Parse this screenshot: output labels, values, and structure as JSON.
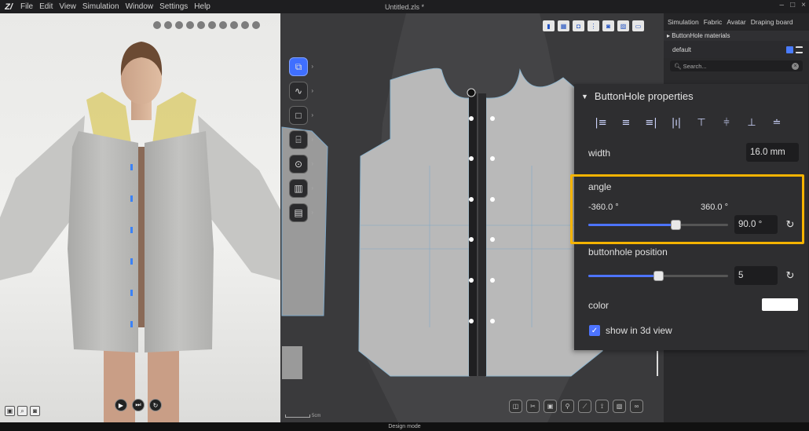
{
  "app": {
    "logo": "Z/",
    "document_title": "Untitled.zls *",
    "menu": [
      "File",
      "Edit",
      "View",
      "Simulation",
      "Window",
      "Settings",
      "Help"
    ],
    "window_controls": [
      "–",
      "□",
      "×"
    ]
  },
  "view3d": {
    "toolbar_icons": [
      "hide-icon",
      "texture-icon",
      "layers-icon",
      "avatar-icon",
      "fabric-icon",
      "color-icon",
      "pattern-icon",
      "pin-icon",
      "sewing-icon",
      "measure-icon"
    ],
    "bottom_icons": [
      "screenshot-icon",
      "zoom-icon",
      "camera-icon"
    ],
    "playback": [
      "play-icon",
      "step-icon",
      "reset-icon"
    ]
  },
  "view2d": {
    "left_tools": [
      "transform-pattern-icon",
      "segment-icon",
      "rectangle-icon",
      "sewing-icon",
      "button-icon",
      "map-icon",
      "tape-icon"
    ],
    "top_icons": [
      "fit-icon",
      "sheet-icon",
      "pin-icon",
      "sewing-view-icon",
      "notch-icon",
      "grainline-icon",
      "info-icon"
    ],
    "bottom_icons": [
      "select-icon",
      "cut-icon",
      "fold-icon",
      "tack-icon",
      "strap-icon",
      "pin2-icon",
      "glue-icon",
      "link-icon"
    ],
    "scale": "5cm"
  },
  "right_panel": {
    "tabs": [
      "Simulation",
      "Fabric",
      "Avatar",
      "Draping board"
    ],
    "section": "▸ ButtonHole materials",
    "default_label": "default",
    "search_placeholder": "Search...",
    "search_clear": "×"
  },
  "buttonhole_panel": {
    "title": "ButtonHole properties",
    "collapse_glyph": "▼",
    "align_icons": [
      "|≡",
      "≡",
      "≡|",
      "|ı|",
      "⊤",
      "⫩",
      "⊥",
      "≐"
    ],
    "width_label": "width",
    "width_value": "16.0 mm",
    "angle_label": "angle",
    "angle_min": "-360.0 °",
    "angle_max": "360.0 °",
    "angle_value": "90.0 °",
    "angle_fraction": 0.625,
    "position_label": "buttonhole position",
    "position_value": "5",
    "position_fraction": 0.5,
    "color_label": "color",
    "color_value": "#ffffff",
    "show3d_label": "show in 3d view",
    "show3d_checked": true,
    "reset_glyph": "↻"
  },
  "status_bar": {
    "mode": "Design mode"
  },
  "colors": {
    "accent": "#4d74ff",
    "highlight": "#f4b300"
  }
}
